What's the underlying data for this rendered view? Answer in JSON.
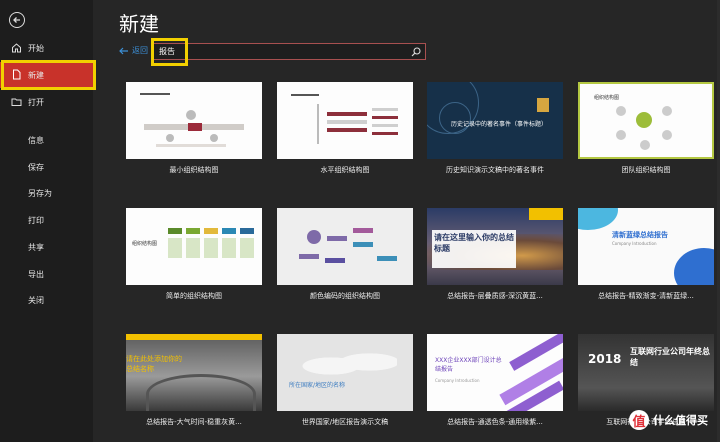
{
  "sidebar": {
    "items": [
      {
        "label": "开始",
        "icon": "home-icon"
      },
      {
        "label": "新建",
        "icon": "new-doc-icon",
        "active": true
      },
      {
        "label": "打开",
        "icon": "folder-open-icon"
      },
      {
        "label": "信息"
      },
      {
        "label": "保存"
      },
      {
        "label": "另存为"
      },
      {
        "label": "打印"
      },
      {
        "label": "共享"
      },
      {
        "label": "导出"
      },
      {
        "label": "关闭"
      }
    ]
  },
  "header": {
    "title": "新建"
  },
  "search": {
    "back_label": "返回",
    "query": "报告"
  },
  "templates": [
    {
      "caption": "最小组织结构图",
      "theme": "white-org"
    },
    {
      "caption": "水平组织结构图",
      "theme": "white-horizontal-org"
    },
    {
      "caption": "历史知识演示文稿中的著名事件",
      "theme": "navy-history",
      "title_text": "历史记录中的著名事件（事件标题）"
    },
    {
      "caption": "团队组织结构图",
      "theme": "green-team",
      "title_text": "组织结构图"
    },
    {
      "caption": "简单的组织结构图",
      "theme": "white-simple",
      "title_text": "组织结构图"
    },
    {
      "caption": "颜色编码的组织结构图",
      "theme": "grey-color"
    },
    {
      "caption": "总结报告-层叠质感-深沉黄蓝...",
      "theme": "blue-yellow",
      "title_text": "请在这里输入你的总结标题"
    },
    {
      "caption": "总结报告-精致渐变-清新蓝绿...",
      "theme": "blue-gradient",
      "title_text": "清新蓝绿总结报告",
      "subtitle_text": "Company Introduction"
    },
    {
      "caption": "总结报告-大气时间-稳重灰黄...",
      "theme": "grey-yellow",
      "title_text": "请在此处添加你的总结名称"
    },
    {
      "caption": "世界国家/地区报告演示文稿",
      "theme": "world-map",
      "title_text": "所在国家/地区的名称"
    },
    {
      "caption": "总结报告-通透色条-通用缘紫...",
      "theme": "purple-stripes",
      "title_text": "XXX企业XXX部门设计总结报告",
      "subtitle_text": "Company Introduction"
    },
    {
      "caption": "互联网行业-公司年终总结",
      "theme": "dark-2018",
      "title_text": "互联网行业公司年终总结",
      "year_text": "2018"
    }
  ],
  "watermark": {
    "text": "什么值得买",
    "icon": "zhi-icon",
    "glyph": "值"
  },
  "colors": {
    "accent": "#c8322a",
    "highlight": "#f2d000",
    "link": "#3c8fd6"
  }
}
